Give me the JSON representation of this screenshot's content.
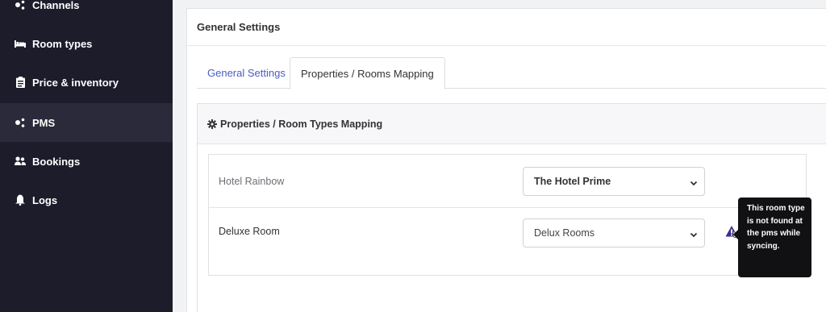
{
  "sidebar": {
    "items": [
      {
        "label": "Channels",
        "icon": "channels-icon"
      },
      {
        "label": "Room types",
        "icon": "bed-icon"
      },
      {
        "label": "Price & inventory",
        "icon": "clipboard-icon"
      },
      {
        "label": "PMS",
        "icon": "pms-icon",
        "active": true
      },
      {
        "label": "Bookings",
        "icon": "users-icon"
      },
      {
        "label": "Logs",
        "icon": "bell-icon"
      }
    ]
  },
  "main": {
    "header_title": "General Settings",
    "tabs": [
      {
        "label": "General Settings",
        "active": false
      },
      {
        "label": "Properties / Rooms Mapping",
        "active": true
      }
    ],
    "section_title": "Properties / Room Types Mapping",
    "rows": [
      {
        "label": "Hotel Rainbow",
        "selected": "The Hotel Prime"
      },
      {
        "label": "Deluxe Room",
        "selected": "Delux Rooms"
      }
    ],
    "tooltip": "This room type is not found at the pms while syncing."
  },
  "colors": {
    "sidebar_bg": "#1c1c2b",
    "sidebar_active": "#2a2a3b",
    "tab_link": "#4a5cc4",
    "warning_icon": "#3a2f8a",
    "tooltip_bg": "#111114"
  }
}
